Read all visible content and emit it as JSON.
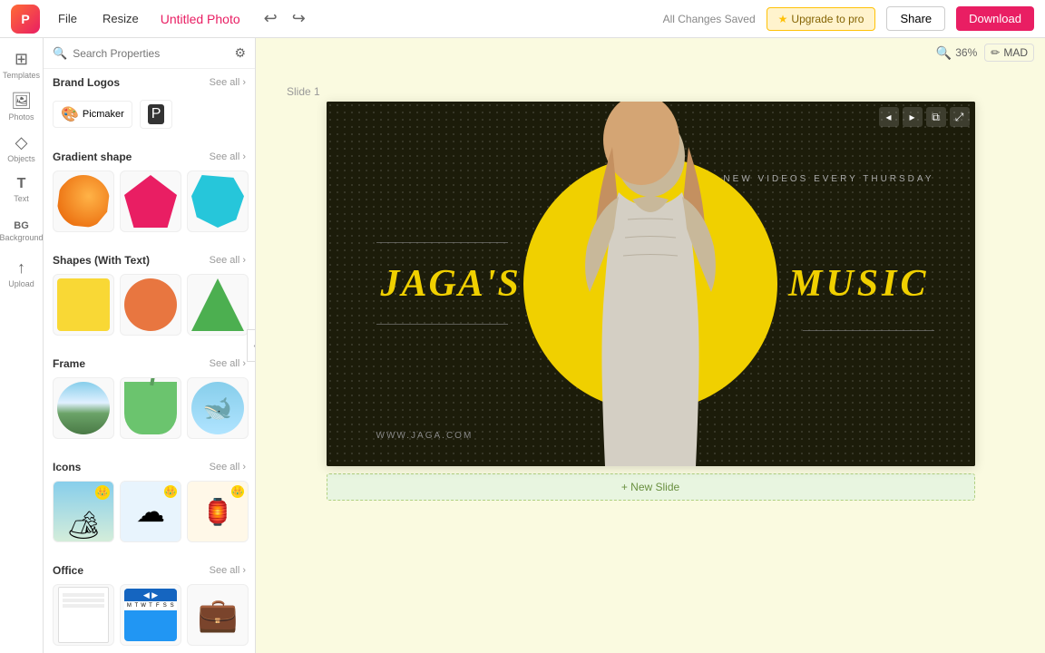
{
  "topbar": {
    "logo_text": "P",
    "nav_file": "File",
    "nav_resize": "Resize",
    "title": "Untitled Photo",
    "undo_symbol": "↩",
    "redo_symbol": "↪",
    "saved_text": "All Changes Saved",
    "upgrade_star": "★",
    "upgrade_label": "Upgrade to pro",
    "share_label": "Share",
    "download_label": "Download"
  },
  "icon_sidebar": {
    "items": [
      {
        "name": "templates-icon",
        "symbol": "⊞",
        "label": "Templates"
      },
      {
        "name": "photos-icon",
        "symbol": "🖼",
        "label": "Photos"
      },
      {
        "name": "objects-icon",
        "symbol": "◇",
        "label": "Objects"
      },
      {
        "name": "text-icon",
        "symbol": "T",
        "label": "Text"
      },
      {
        "name": "background-icon",
        "symbol": "BG",
        "label": "Background"
      },
      {
        "name": "upload-icon",
        "symbol": "↑",
        "label": "Upload"
      }
    ]
  },
  "props_panel": {
    "search_placeholder": "Search Properties",
    "filter_icon": "⚙",
    "sections": [
      {
        "id": "brand-logos",
        "title": "Brand Logos",
        "see_all": "See all ›",
        "items": [
          {
            "name": "Picmaker",
            "icon": "P"
          },
          {
            "name": "pm2",
            "icon": "🅿"
          }
        ]
      },
      {
        "id": "gradient-shape",
        "title": "Gradient shape",
        "see_all": "See all ›"
      },
      {
        "id": "shapes-with-text",
        "title": "Shapes (With Text)",
        "see_all": "See all ›"
      },
      {
        "id": "frame",
        "title": "Frame",
        "see_all": "See all ›"
      },
      {
        "id": "icons",
        "title": "Icons",
        "see_all": "See all ›"
      },
      {
        "id": "office",
        "title": "Office",
        "see_all": "See all ›"
      }
    ]
  },
  "canvas": {
    "zoom_icon": "🔍",
    "zoom_level": "36%",
    "pencil_icon": "✏",
    "mad_label": "MAD",
    "slide_label": "Slide 1",
    "slide_content": {
      "new_videos_text": "NEW VIDEOS EVERY THURSDAY",
      "jaga_text": "JAGA'S",
      "music_text": "MUSIC",
      "www_text": "WWW.JAGA.COM"
    },
    "new_slide_label": "+ New Slide"
  }
}
